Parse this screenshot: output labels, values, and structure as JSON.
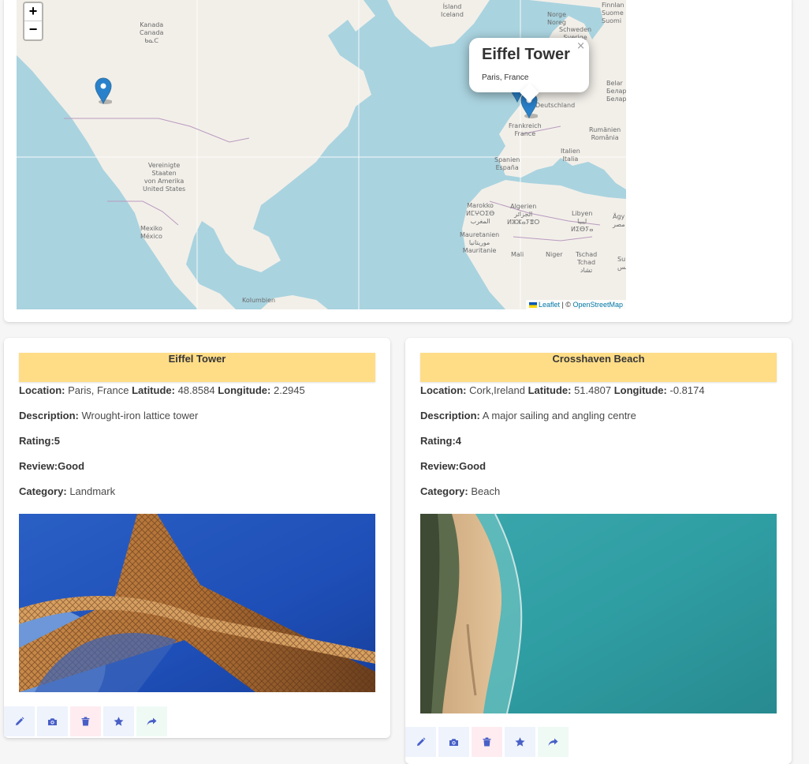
{
  "map": {
    "zoom_in": "+",
    "zoom_out": "−",
    "labels": {
      "kanada": "Kanada\nCanada\nᑲᓇᑕ",
      "island": "Ísland\nIceland",
      "norge": "Norge\nNoreg",
      "finnland": "Finnlan\nSuome\nSuomi",
      "schweden": "Schweden\nSverige",
      "belarus": "Belar\nБелар\nБелар",
      "deutschland": "Deutschland",
      "frankreich": "Frankreich\nFrance",
      "romanien": "Rumänien\nRomânia",
      "italien": "Italien\nItalia",
      "spanien": "Spanien\nEspaña",
      "usa": "Vereinigte\nStaaten\nvon Amerika\nUnited States",
      "marokko": "Marokko\nⵍⵎⵖⵔⵉⴱ\nالمغرب",
      "algerien": "Algerien\nالجزائر\nⵍⵣⵣⴰⵢⴻⵔ",
      "libyen": "Libyen\nليبيا\nⵍⵉⴱⵢⴰ",
      "agypten": "Ägy\nمصر",
      "mexiko": "Mexiko\nMéxico",
      "mauretanien": "Mauretanien\nموريتانيا\nMauritanie",
      "mali": "Mali",
      "niger": "Niger",
      "tschad": "Tschad\nTchad\nتشاد",
      "sudan": "Su\nالس",
      "kolumbien": "Kolumbien"
    },
    "popup": {
      "title": "Eiffel Tower",
      "subtitle": "Paris, France",
      "close": "×"
    },
    "attribution": {
      "leaflet": "Leaflet",
      "separator": " | © ",
      "osm": "OpenStreetMap"
    }
  },
  "places": [
    {
      "name": "Eiffel Tower",
      "location_label": "Location:",
      "location": "Paris, France",
      "latitude_label": "Latitude:",
      "latitude": "48.8584",
      "longitude_label": "Longitude:",
      "longitude": "2.2945",
      "description_label": "Description:",
      "description": "Wrought-iron lattice tower",
      "rating": "Rating:5",
      "review": "Review:Good",
      "category_label": "Category:",
      "category": "Landmark",
      "image": "eiffel-tower-photo"
    },
    {
      "name": "Crosshaven Beach",
      "location_label": "Location:",
      "location": "Cork,Ireland",
      "latitude_label": "Latitude:",
      "latitude": "51.4807",
      "longitude_label": "Longitude:",
      "longitude": "-0.8174",
      "description_label": "Description:",
      "description": "A major sailing and angling centre",
      "rating": "Rating:4",
      "review": "Review:Good",
      "category_label": "Category:",
      "category": "Beach",
      "image": "beach-aerial-photo"
    }
  ],
  "actions": [
    "edit-icon",
    "camera-icon",
    "trash-icon",
    "star-icon",
    "share-icon"
  ],
  "colors": {
    "accent": "#485fc7",
    "danger": "#f14668",
    "success": "#48c78e",
    "header": "#ffdd87",
    "marker": "#2a81cb"
  }
}
